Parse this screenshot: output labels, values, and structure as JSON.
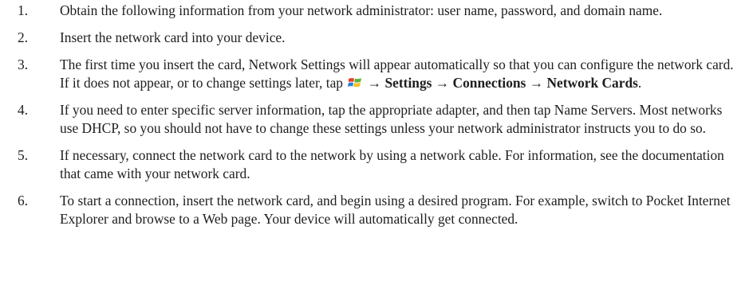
{
  "steps": [
    {
      "number": "1.",
      "text": "Obtain the following information from your network administrator: user name, password, and domain name."
    },
    {
      "number": "2.",
      "text": "Insert the network card into your device."
    },
    {
      "number": "3.",
      "text_before_icon": "The first time you insert the card, Network Settings will appear automatically so that you can configure the network card. If it does not appear, or to change settings later, tap",
      "icon": "windows-start-icon",
      "arrow1": "→",
      "bold1": "Settings",
      "arrow2": "→",
      "bold2": "Connections",
      "arrow3": "→",
      "bold3": "Network Cards",
      "end": "."
    },
    {
      "number": "4.",
      "text": "If you need to enter specific server information, tap the appropriate adapter, and then tap Name Servers. Most networks use DHCP, so you should not have to change these settings unless your network administrator instructs you to do so."
    },
    {
      "number": "5.",
      "text": "If necessary, connect the network card to the network by using a network cable. For information, see the documentation that came with your network card."
    },
    {
      "number": "6.",
      "text": "To start a connection, insert the network card, and begin using a desired program. For example, switch to Pocket Internet Explorer and browse to a Web page. Your device will automatically get connected."
    }
  ],
  "colors": {
    "text": "#1e1e1e",
    "start_red": "#e8402a",
    "start_green": "#5fb33b",
    "start_blue": "#2b7fd9",
    "start_yellow": "#f6c22b"
  }
}
